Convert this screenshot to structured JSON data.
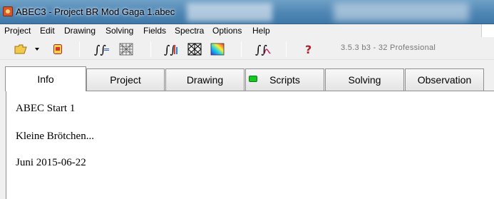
{
  "window": {
    "title": "ABEC3 - Project BR Mod Gaga 1.abec"
  },
  "menu": [
    "Project",
    "Edit",
    "Drawing",
    "Solving",
    "Fields",
    "Spectra",
    "Options",
    "Help"
  ],
  "toolbar": {
    "icons": [
      "open-folder-icon",
      "dropdown-arrow-icon",
      "save-icon",
      "solve-integral-icon",
      "mesh-icon",
      "spectra-icon",
      "field-mesh-icon",
      "field-gradient-icon",
      "integral-curve-icon",
      "help-icon"
    ],
    "version": "3.5.3 b3 - 32 Professional"
  },
  "tabs": [
    "Info",
    "Project",
    "Drawing",
    "Scripts",
    "Solving",
    "Observation"
  ],
  "active_tab": "Info",
  "scripts_status_color": "#14c81e",
  "info": {
    "lines": [
      "ABEC Start 1",
      "Kleine Brötchen...",
      "Juni 2015-06-22"
    ]
  }
}
